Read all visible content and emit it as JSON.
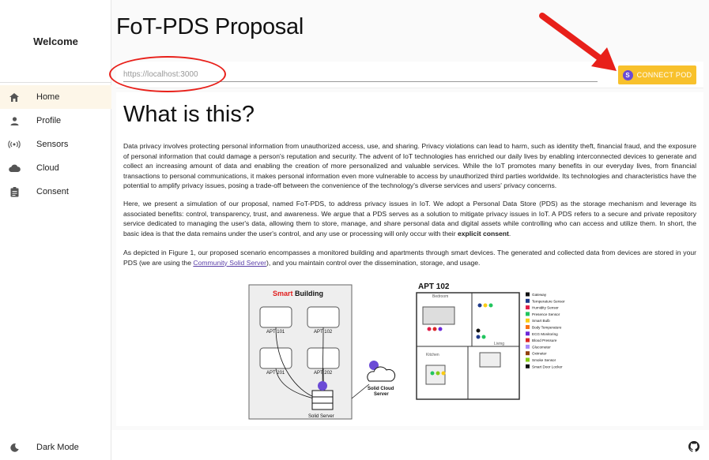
{
  "sidebar": {
    "welcome": "Welcome",
    "items": [
      {
        "label": "Home",
        "icon": "home-icon",
        "active": true
      },
      {
        "label": "Profile",
        "icon": "person-icon",
        "active": false
      },
      {
        "label": "Sensors",
        "icon": "sensors-icon",
        "active": false
      },
      {
        "label": "Cloud",
        "icon": "cloud-icon",
        "active": false
      },
      {
        "label": "Consent",
        "icon": "clipboard-icon",
        "active": false
      }
    ],
    "dark_mode": "Dark Mode"
  },
  "header": {
    "title": "FoT-PDS Proposal",
    "url_placeholder": "https://localhost:3000",
    "connect_label": "CONNECT POD"
  },
  "content": {
    "heading": "What is this?",
    "p1": "Data privacy involves protecting personal information from unauthorized access, use, and sharing. Privacy violations can lead to harm, such as identity theft, financial fraud, and the exposure of personal information that could damage a person's reputation and security. The advent of IoT technologies has enriched our daily lives by enabling interconnected devices to generate and collect an increasing amount of data and enabling the creation of more personalized and valuable services. While the IoT promotes many benefits in our everyday lives, from financial transactions to personal communications, it makes personal information even more vulnerable to access by unauthorized third parties worldwide. Its technologies and characteristics have the potential to amplify privacy issues, posing a trade-off between the convenience of the technology's diverse services and users' privacy concerns.",
    "p2_main": "Here, we present a simulation of our proposal, named FoT-PDS, to address privacy issues in IoT. We adopt a Personal Data Store (PDS) as the storage mechanism and leverage its associated benefits: control, transparency, trust, and awareness. We argue that a PDS serves as a solution to mitigate privacy issues in IoT. A PDS refers to a secure and private repository service dedicated to managing the user's data, allowing them to store, manage, and share personal data and digital assets while controlling who can access and utilize them. In short, the basic idea is that the data remains under the user's control, and any use or processing will only occur with their ",
    "p2_bold": "explicit consent",
    "p2_end": ".",
    "p3_a": "As depicted in Figure 1, our proposed scenario encompasses a monitored building and apartments through smart devices. The generated and collected data from devices are stored in your PDS (we are using the ",
    "p3_link": "Community Solid Server",
    "p3_b": "), and you maintain control over the dissemination, storage, and usage."
  },
  "figure": {
    "smart_title_red": "Smart",
    "smart_title_black": " Building",
    "apts": [
      "APT 101",
      "APT 102",
      "APT 201",
      "APT 202"
    ],
    "solid_server": "Solid Server",
    "solid_cloud_1": "Solid Cloud",
    "solid_cloud_2": "Server",
    "apt_title": "APT 102",
    "rooms": [
      "Bedroom",
      "Kitchen",
      "Living"
    ],
    "legend": [
      {
        "label": "Gateway",
        "color": "#111111"
      },
      {
        "label": "Temperature Sensor",
        "color": "#1e3a8a"
      },
      {
        "label": "Humidity Sensor",
        "color": "#e11d48"
      },
      {
        "label": "Presence Sensor",
        "color": "#22c55e"
      },
      {
        "label": "Smart Bulb",
        "color": "#facc15"
      },
      {
        "label": "Body Temperature",
        "color": "#f97316"
      },
      {
        "label": "ECG Monitoring",
        "color": "#6d28d9"
      },
      {
        "label": "Blood Pressure",
        "color": "#dc2626"
      },
      {
        "label": "Glucometer",
        "color": "#a78bfa"
      },
      {
        "label": "Oximeter",
        "color": "#92400e"
      },
      {
        "label": "Smoke Sensor",
        "color": "#84cc16"
      },
      {
        "label": "Smart Door Locker",
        "color": "#111111"
      }
    ]
  },
  "colors": {
    "accent": "#f8c12c",
    "annotation": "#e8201a",
    "link": "#5b3fa8"
  }
}
